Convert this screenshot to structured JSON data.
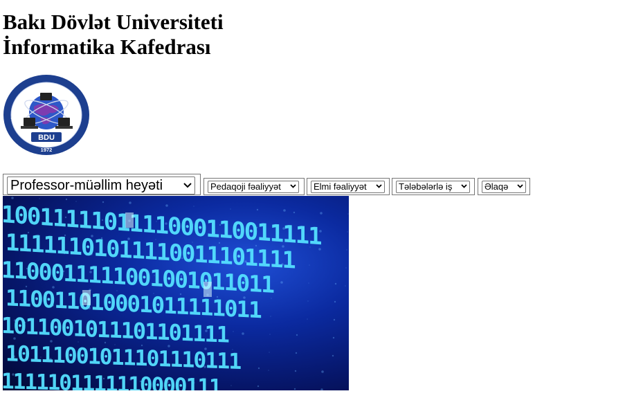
{
  "header": {
    "university": "Bakı Dövlət Universiteti",
    "department": "İnformatika Kafedrası"
  },
  "logo": {
    "ring_text": "TƏTBİQİ RİYAZİYYAT VƏ KİBERNETİKA FAKÜLTƏSİ",
    "abbr": "BDU",
    "year": "1972",
    "colors": {
      "ring": "#1d3f8f",
      "inner": "#ffffff"
    }
  },
  "nav": {
    "menus": [
      {
        "selected": "Professor-müəllim heyəti"
      },
      {
        "selected": "Pedaqoji fəaliyyət"
      },
      {
        "selected": "Elmi fəaliyyət"
      },
      {
        "selected": "Tələbələrlə iş"
      },
      {
        "selected": "Əlaqə"
      }
    ]
  },
  "hero": {
    "rows": [
      "1001111101111000110011111",
      "11111101011110011101111",
      "1100011111001001011011",
      "110011010001011111011",
      "1011001011101101111",
      "10111001011101110111",
      "1111101111110000111"
    ],
    "colors": {
      "digit": "#55e0ff",
      "digit_bright": "#d8faff",
      "bg": "#061566"
    }
  }
}
